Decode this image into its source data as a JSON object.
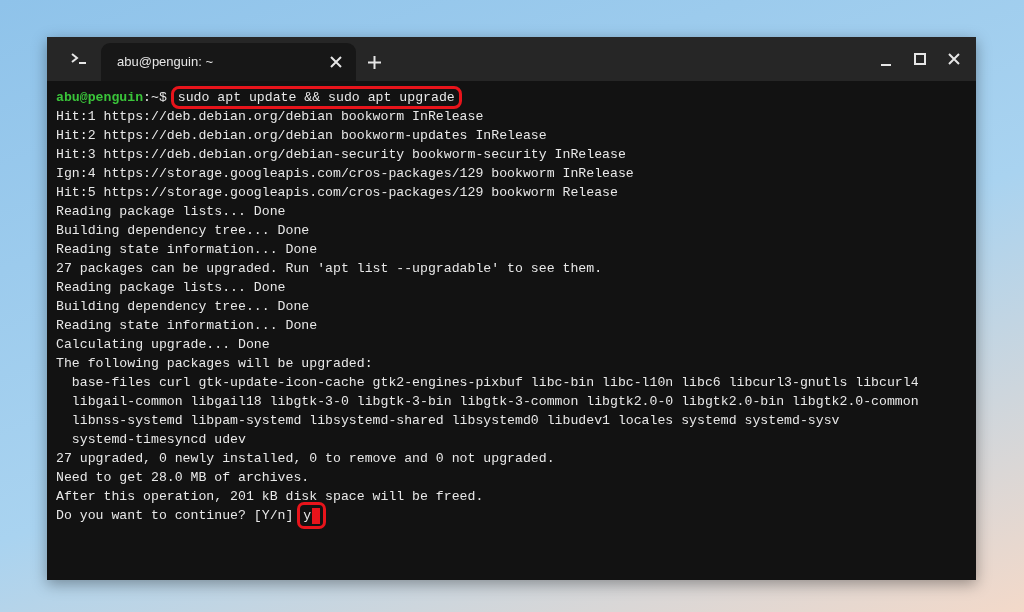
{
  "window": {
    "tabs": [
      {
        "title": "abu@penguin: ~",
        "selected": true
      }
    ]
  },
  "terminal": {
    "lines": [
      {
        "kind": "prompt",
        "user": "abu@penguin",
        "path": ":~$",
        "command": "sudo apt update && sudo apt upgrade",
        "highlighted": true
      },
      {
        "kind": "output",
        "text": "Hit:1 https://deb.debian.org/debian bookworm InRelease"
      },
      {
        "kind": "output",
        "text": "Hit:2 https://deb.debian.org/debian bookworm-updates InRelease"
      },
      {
        "kind": "output",
        "text": "Hit:3 https://deb.debian.org/debian-security bookworm-security InRelease"
      },
      {
        "kind": "output",
        "text": "Ign:4 https://storage.googleapis.com/cros-packages/129 bookworm InRelease"
      },
      {
        "kind": "output",
        "text": "Hit:5 https://storage.googleapis.com/cros-packages/129 bookworm Release"
      },
      {
        "kind": "output",
        "text": "Reading package lists... Done"
      },
      {
        "kind": "output",
        "text": "Building dependency tree... Done"
      },
      {
        "kind": "output",
        "text": "Reading state information... Done"
      },
      {
        "kind": "output",
        "text": "27 packages can be upgraded. Run 'apt list --upgradable' to see them."
      },
      {
        "kind": "output",
        "text": "Reading package lists... Done"
      },
      {
        "kind": "output",
        "text": "Building dependency tree... Done"
      },
      {
        "kind": "output",
        "text": "Reading state information... Done"
      },
      {
        "kind": "output",
        "text": "Calculating upgrade... Done"
      },
      {
        "kind": "output",
        "text": "The following packages will be upgraded:"
      },
      {
        "kind": "output",
        "text": "  base-files curl gtk-update-icon-cache gtk2-engines-pixbuf libc-bin libc-l10n libc6 libcurl3-gnutls libcurl4"
      },
      {
        "kind": "output",
        "text": "  libgail-common libgail18 libgtk-3-0 libgtk-3-bin libgtk-3-common libgtk2.0-0 libgtk2.0-bin libgtk2.0-common"
      },
      {
        "kind": "output",
        "text": "  libnss-systemd libpam-systemd libsystemd-shared libsystemd0 libudev1 locales systemd systemd-sysv"
      },
      {
        "kind": "output",
        "text": "  systemd-timesyncd udev"
      },
      {
        "kind": "output",
        "text": "27 upgraded, 0 newly installed, 0 to remove and 0 not upgraded."
      },
      {
        "kind": "output",
        "text": "Need to get 28.0 MB of archives."
      },
      {
        "kind": "output",
        "text": "After this operation, 201 kB disk space will be freed."
      },
      {
        "kind": "question",
        "text": "Do you want to continue? [Y/n]",
        "answer": "y",
        "highlighted": true
      }
    ]
  }
}
